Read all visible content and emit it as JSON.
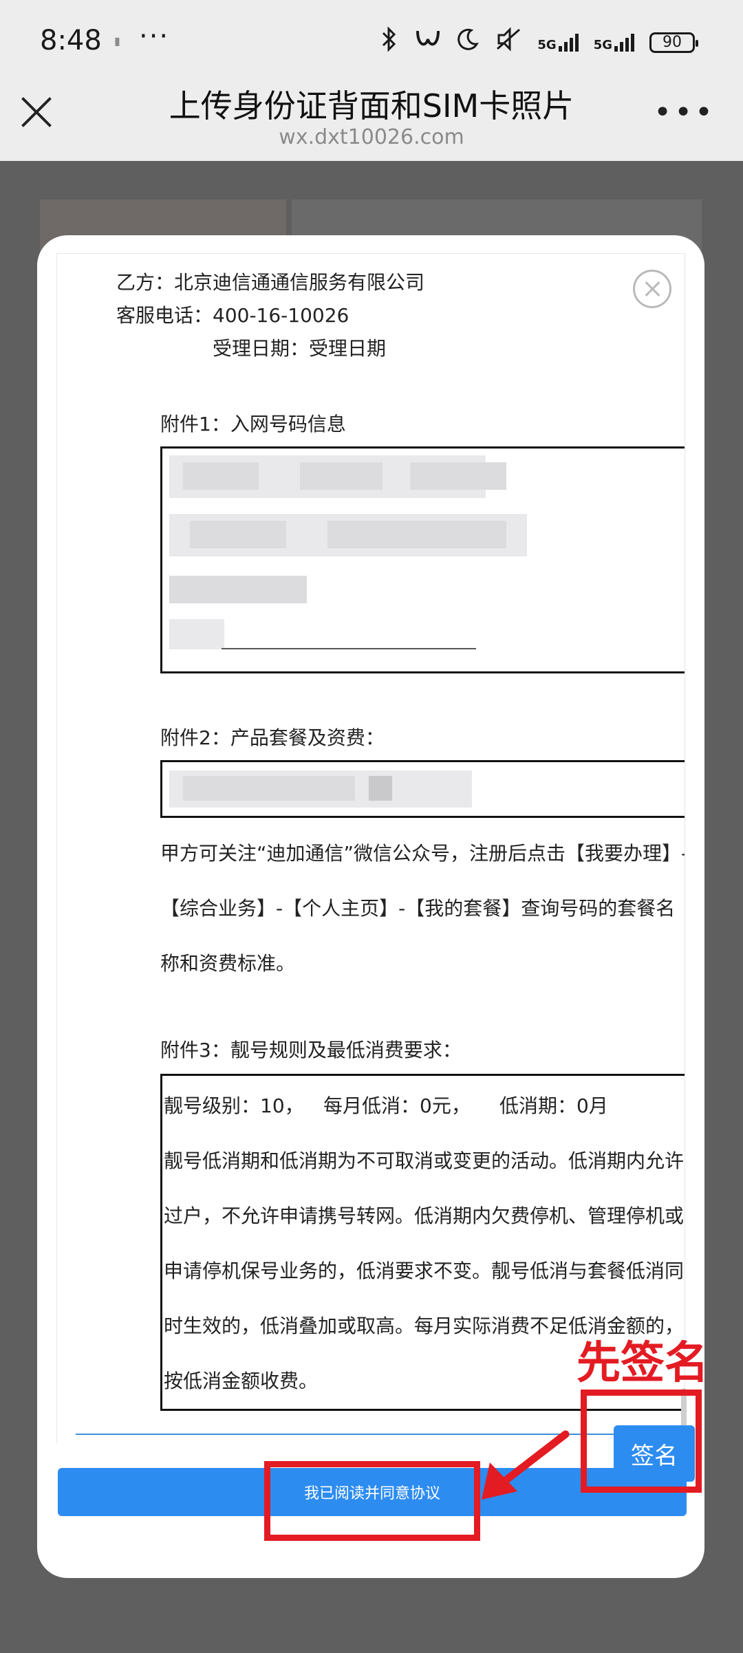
{
  "status_bar": {
    "time": "8:48",
    "more_glyph": "···",
    "network": [
      "5G",
      "5G"
    ],
    "battery": "90",
    "icons": [
      "bluetooth-icon",
      "vibrate-icon",
      "moon-icon",
      "mute-icon",
      "signal-icon",
      "battery-icon"
    ]
  },
  "header": {
    "title": "上传身份证背面和SIM卡照片",
    "url": "wx.dxt10026.com",
    "more": "•••"
  },
  "doc": {
    "party_b": "乙方：北京迪信通通信服务有限公司",
    "service_phone": "客服电话：400-16-10026",
    "accept_date": "受理日期：受理日期",
    "att1_title": "附件1：入网号码信息",
    "att2_title": "附件2：产品套餐及资费：",
    "att2_lines": [
      "甲方可关注“迪加通信”微信公众号，注册后点击【我要办理】-",
      "【综合业务】-【个人主页】-【我的套餐】查询号码的套餐名",
      "称和资费标准。"
    ],
    "att3_title": "附件3：靓号规则及最低消费要求：",
    "att3_summary": {
      "level": "靓号级别：10，",
      "monthly_min": "每月低消：0元，",
      "min_period": "低消期：0月"
    },
    "att3_lines": [
      "靓号低消期和低消期为不可取消或变更的活动。低消期内允许",
      "过户，不允许申请携号转网。低消期内欠费停机、管理停机或",
      "申请停机保号业务的，低消要求不变。靓号低消与套餐低消同",
      "时生效的，低消叠加或取高。每月实际消费不足低消金额的，",
      "按低消金额收费。"
    ]
  },
  "buttons": {
    "sign": "签名",
    "agree": "我已阅读并同意协议"
  },
  "annotation": {
    "text": "先签名",
    "color": "#e31b23"
  },
  "colors": {
    "accent": "#2d8cf0",
    "overlay": "#5f5f5f",
    "header_bg": "#ededed"
  }
}
